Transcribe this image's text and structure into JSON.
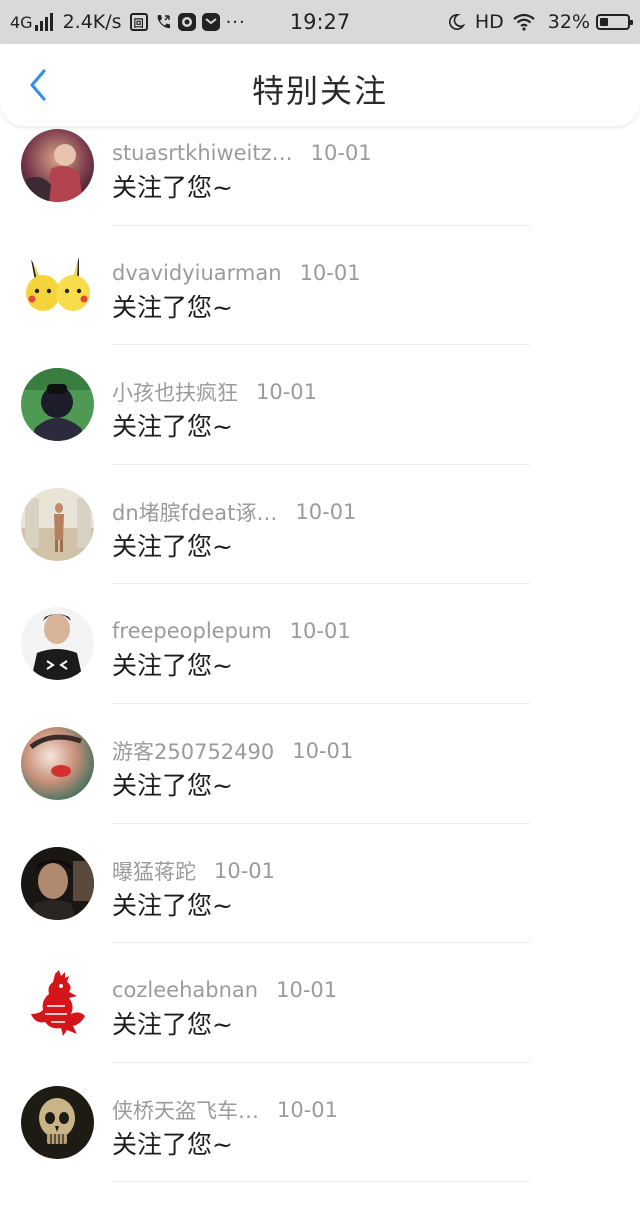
{
  "status_bar": {
    "network": "4G",
    "speed": "2.4K/s",
    "time": "19:27",
    "hd": "HD",
    "battery_percent": "32%",
    "battery_level": 0.32,
    "more": "···",
    "icons": [
      "signal-icon",
      "sim-icon",
      "phone-icon",
      "record-icon",
      "message-icon",
      "moon-icon",
      "wifi-icon",
      "battery-icon"
    ]
  },
  "header": {
    "title": "特别关注",
    "back_icon": "chevron-left-icon",
    "accent_color": "#3a8ee6"
  },
  "notifications": [
    {
      "name": "stuasrtkhiweitz…",
      "date": "10-01",
      "message": "关注了您~",
      "avatar": "photo-avatar"
    },
    {
      "name": "dvavidyiuarman",
      "date": "10-01",
      "message": "关注了您~",
      "avatar": "pikachu-avatar"
    },
    {
      "name": "小孩也扶疯狂",
      "date": "10-01",
      "message": "关注了您~",
      "avatar": "photo-avatar"
    },
    {
      "name": "dn堵膑fdeat诼…",
      "date": "10-01",
      "message": "关注了您~",
      "avatar": "photo-avatar"
    },
    {
      "name": "freepeoplepum",
      "date": "10-01",
      "message": "关注了您~",
      "avatar": "photo-avatar"
    },
    {
      "name": "游客250752490",
      "date": "10-01",
      "message": "关注了您~",
      "avatar": "photo-avatar"
    },
    {
      "name": "曝猛蒋跎",
      "date": "10-01",
      "message": "关注了您~",
      "avatar": "photo-avatar"
    },
    {
      "name": "cozleehabnan",
      "date": "10-01",
      "message": "关注了您~",
      "avatar": "rooster-avatar"
    },
    {
      "name": "侠桥天盗飞车…",
      "date": "10-01",
      "message": "关注了您~",
      "avatar": "skull-avatar"
    }
  ]
}
